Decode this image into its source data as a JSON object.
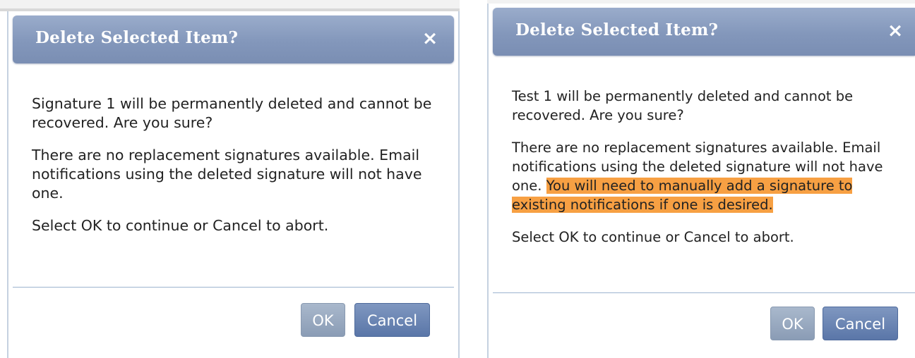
{
  "dialogs": [
    {
      "title": "Delete Selected Item?",
      "close_icon": "×",
      "message1": "Signature 1 will be permanently deleted and cannot be recovered. Are you sure?",
      "message2": "There are no replacement signatures available. Email notifications using the deleted signature will not have one.",
      "message2_highlight": "",
      "message3": "Select OK to continue or Cancel to abort.",
      "ok_label": "OK",
      "cancel_label": "Cancel"
    },
    {
      "title": "Delete Selected Item?",
      "close_icon": "×",
      "message1": "Test 1 will be permanently deleted and cannot be recovered. Are you sure?",
      "message2": "There are no replacement signatures available. Email notifications using the deleted signature will not have one. ",
      "message2_highlight": "You will need to manually add a signature to existing notifications if one is desired.",
      "message3": "Select OK to continue or Cancel to abort.",
      "ok_label": "OK",
      "cancel_label": "Cancel"
    }
  ],
  "colors": {
    "titlebar": "#8397bb",
    "highlight": "#f7a043",
    "cancel_button": "#5a76a8",
    "ok_button": "#8a9cb5",
    "divider": "#9cb3cf"
  },
  "icons": {
    "close": "close-icon"
  }
}
